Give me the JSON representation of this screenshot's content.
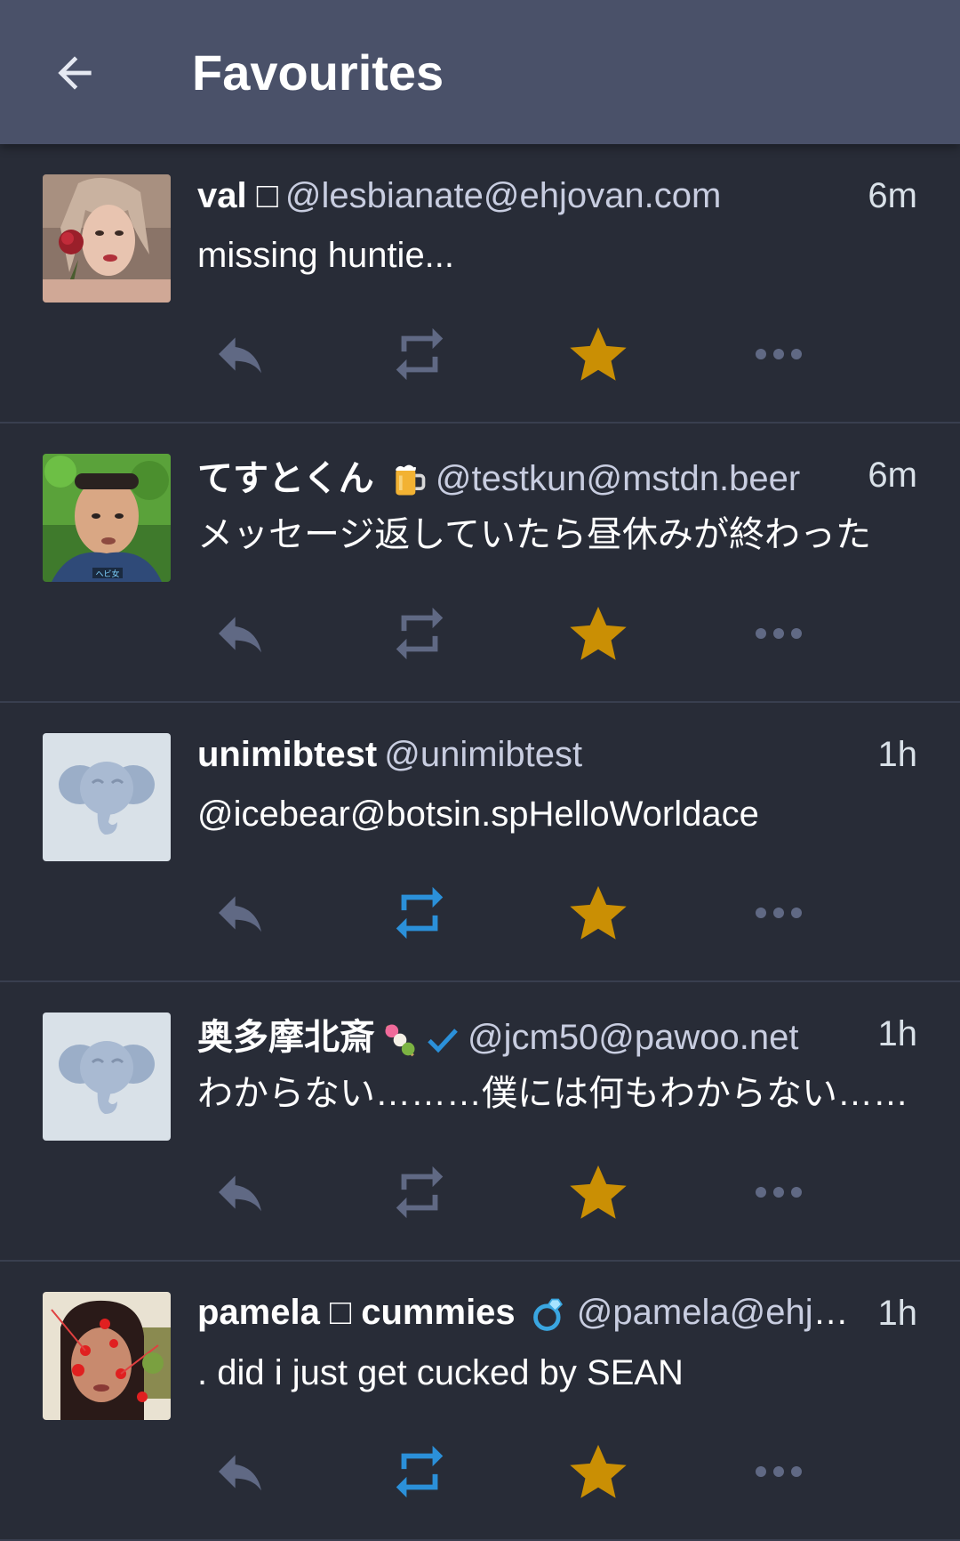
{
  "header": {
    "title": "Favourites",
    "back_icon": "arrow-left-icon"
  },
  "colors": {
    "background": "#282c37",
    "app_bar": "#4a5169",
    "icon_inactive": "#606984",
    "boost_active": "#2b90d9",
    "favourite_active": "#ca8f04",
    "verified_check": "#2b90d9"
  },
  "statuses": [
    {
      "display_name": "val ",
      "name_emoji": "□",
      "handle": "@lesbianate@ehjovan.com",
      "time": "6m",
      "content": "missing huntie...",
      "avatar": "photo",
      "boosted": false,
      "favourited": true
    },
    {
      "display_name": "てすとくん ",
      "name_emoji": "beer-mug-icon",
      "handle": "@testkun@mstdn.beer",
      "time": "6m",
      "content": "メッセージ返していたら昼休みが終わった",
      "avatar": "photo",
      "boosted": false,
      "favourited": true
    },
    {
      "display_name": "unimibtest",
      "handle": "@unimibtest",
      "time": "1h",
      "content": "@icebear@botsin.spHelloWorldace",
      "avatar": "default-elephant",
      "boosted": true,
      "favourited": true
    },
    {
      "display_name": "奥多摩北斎",
      "name_emoji": "dango-icon",
      "name_badge": "check-mark-icon",
      "handle": "@jcm50@pawoo.net",
      "time": "1h",
      "content": "わからない………僕には何もわからない………",
      "avatar": "default-elephant",
      "boosted": false,
      "favourited": true
    },
    {
      "display_name": "pamela ",
      "name_emoji": "□",
      "display_name_suffix": " cummies ",
      "name_emoji_2": "ring-icon",
      "handle": "@pamela@ehjovan.com",
      "time": "1h",
      "content": ". did i just get cucked by SEAN",
      "avatar": "photo",
      "boosted": true,
      "favourited": true
    }
  ]
}
